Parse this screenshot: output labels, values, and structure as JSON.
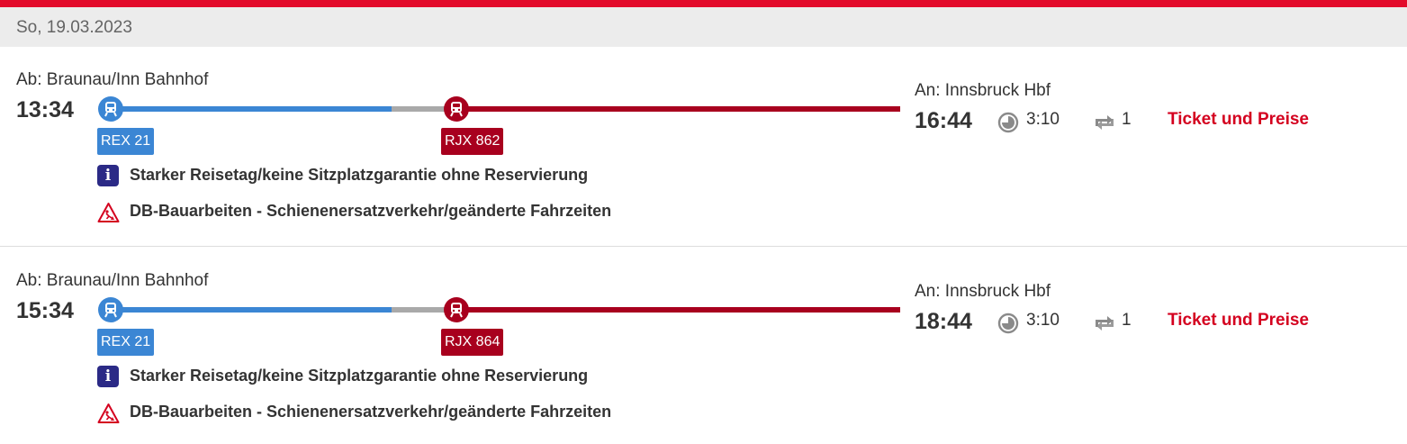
{
  "date_header": "So, 19.03.2023",
  "colors": {
    "brand_red": "#e30b2b",
    "regional_blue": "#3b86d4",
    "longdistance_red": "#a8001e",
    "info_purple": "#2b2a86"
  },
  "icons": {
    "train": "train-front-icon",
    "duration": "clock-icon",
    "changes": "transfer-icon",
    "info": "info-icon",
    "warning": "construction-warning-icon"
  },
  "journeys": [
    {
      "departure_label": "Ab: Braunau/Inn Bahnhof",
      "departure_time": "13:34",
      "arrival_label": "An: Innsbruck Hbf",
      "arrival_time": "16:44",
      "duration": "3:10",
      "changes": "1",
      "legs": [
        {
          "line": "REX 21",
          "color": "#3b86d4"
        },
        {
          "line": "RJX 862",
          "color": "#a8001e"
        }
      ],
      "notices": [
        "Starker Reisetag/keine Sitzplatzgarantie ohne Reservierung",
        "DB-Bauarbeiten - Schienenersatzverkehr/geänderte Fahrzeiten"
      ],
      "ticket_link": "Ticket und Preise"
    },
    {
      "departure_label": "Ab: Braunau/Inn Bahnhof",
      "departure_time": "15:34",
      "arrival_label": "An: Innsbruck Hbf",
      "arrival_time": "18:44",
      "duration": "3:10",
      "changes": "1",
      "legs": [
        {
          "line": "REX 21",
          "color": "#3b86d4"
        },
        {
          "line": "RJX 864",
          "color": "#a8001e"
        }
      ],
      "notices": [
        "Starker Reisetag/keine Sitzplatzgarantie ohne Reservierung",
        "DB-Bauarbeiten - Schienenersatzverkehr/geänderte Fahrzeiten"
      ],
      "ticket_link": "Ticket und Preise"
    }
  ]
}
